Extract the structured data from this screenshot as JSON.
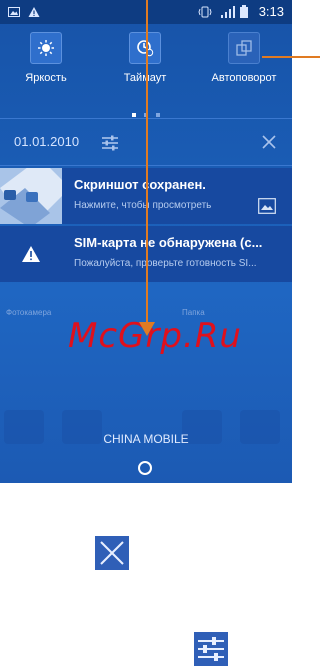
{
  "status_bar": {
    "time": "3:13",
    "icons": [
      "image-icon",
      "warning-icon",
      "vibrate-icon",
      "signal-icon",
      "battery-icon"
    ]
  },
  "quick_settings": {
    "tiles": [
      {
        "label": "Яркость",
        "icon": "brightness-icon"
      },
      {
        "label": "Таймаут",
        "icon": "timeout-icon"
      },
      {
        "label": "Автоповорот",
        "icon": "autorotate-icon"
      }
    ],
    "page_count": 3,
    "active_page": 0
  },
  "date_row": {
    "date": "01.01.2010",
    "settings_icon": "sliders-icon",
    "clear_icon": "close-icon"
  },
  "notifications": [
    {
      "title": "Скриншот сохранен.",
      "subtitle": "Нажмите, чтобы просмотреть",
      "icon": "image-icon"
    },
    {
      "title": "SIM-карта не обнаружена (с...",
      "subtitle": "Пожалуйста, проверьте готовность SI...",
      "icon": "warning-icon"
    }
  ],
  "launcher": {
    "labels": [
      "Фотокамера",
      "Папка"
    ]
  },
  "carrier": "CHINA MOBILE",
  "watermark": "McGrp.Ru",
  "colors": {
    "panel_blue": "#1a5cb4",
    "status_bar": "#0e3c82",
    "callout_orange": "#e07b22",
    "watermark_red": "#e0101c"
  }
}
